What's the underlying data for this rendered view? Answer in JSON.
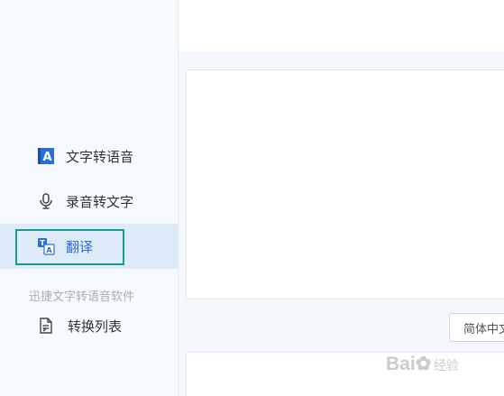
{
  "sidebar": {
    "items": [
      {
        "label": "文字转语音",
        "icon": "text-to-speech-icon",
        "active": false
      },
      {
        "label": "录音转文字",
        "icon": "microphone-icon",
        "active": false
      },
      {
        "label": "翻译",
        "icon": "translate-icon",
        "active": true
      }
    ],
    "software_name": "迅捷文字转语音软件",
    "list_item": {
      "label": "转换列表",
      "icon": "document-list-icon"
    }
  },
  "main": {
    "language_select": {
      "value": "简体中文"
    }
  },
  "watermark": {
    "brand": "Bai",
    "suffix": "经验"
  },
  "colors": {
    "accent": "#2a6fd6",
    "active_bg": "#deeaf8",
    "highlight_border": "#1a9b8c",
    "sidebar_bg": "#f6f9fe"
  }
}
